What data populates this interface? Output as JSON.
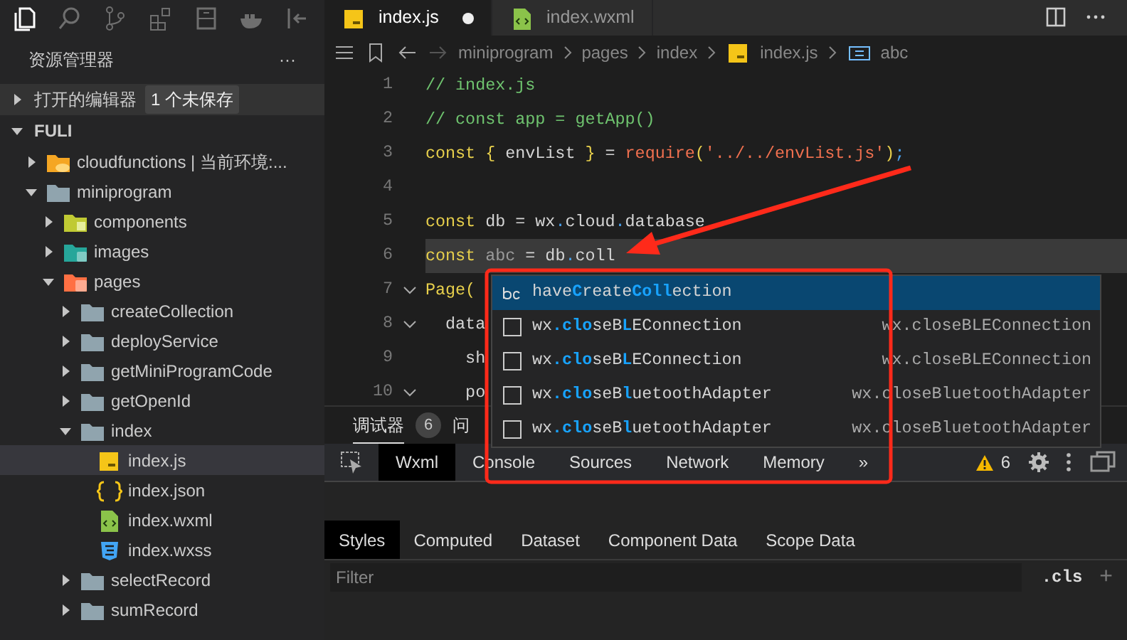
{
  "activity_bar": {
    "icons": [
      {
        "kind": "files",
        "selected": true
      },
      {
        "kind": "search",
        "selected": false
      },
      {
        "kind": "branch",
        "selected": false
      },
      {
        "kind": "extensions",
        "selected": false
      },
      {
        "kind": "storage",
        "selected": false
      },
      {
        "kind": "docker",
        "selected": false
      },
      {
        "kind": "collapse",
        "selected": false
      }
    ]
  },
  "sidebar": {
    "title": "资源管理器",
    "more": "···",
    "open_editors": {
      "label": "打开的编辑器",
      "badge": "1 个未保存",
      "expanded": false
    },
    "project": {
      "label": "FULI",
      "expanded": true
    },
    "tree": [
      {
        "label": "cloudfunctions | 当前环境:...",
        "kind": "cloud-folder",
        "expanded": false,
        "selected": false
      },
      {
        "label": "miniprogram",
        "kind": "folder",
        "expanded": true,
        "selected": false,
        "children": [
          {
            "label": "components",
            "kind": "component-folder",
            "expanded": false,
            "selected": false
          },
          {
            "label": "images",
            "kind": "image-folder",
            "expanded": false,
            "selected": false
          },
          {
            "label": "pages",
            "kind": "pages-folder",
            "expanded": true,
            "selected": false,
            "children": [
              {
                "label": "createCollection",
                "kind": "folder",
                "expanded": false,
                "selected": false
              },
              {
                "label": "deployService",
                "kind": "folder",
                "expanded": false,
                "selected": false
              },
              {
                "label": "getMiniProgramCode",
                "kind": "folder",
                "expanded": false,
                "selected": false
              },
              {
                "label": "getOpenId",
                "kind": "folder",
                "expanded": false,
                "selected": false
              },
              {
                "label": "index",
                "kind": "folder",
                "expanded": true,
                "selected": false,
                "children": [
                  {
                    "label": "index.js",
                    "kind": "js",
                    "selected": true
                  },
                  {
                    "label": "index.json",
                    "kind": "json",
                    "selected": false
                  },
                  {
                    "label": "index.wxml",
                    "kind": "wxml",
                    "selected": false
                  },
                  {
                    "label": "index.wxss",
                    "kind": "wxss",
                    "selected": false
                  }
                ]
              },
              {
                "label": "selectRecord",
                "kind": "folder",
                "expanded": false,
                "selected": false
              },
              {
                "label": "sumRecord",
                "kind": "folder",
                "expanded": false,
                "selected": false
              }
            ]
          }
        ]
      }
    ]
  },
  "editor_tabs": [
    {
      "label": "index.js",
      "kind": "js",
      "selected": true,
      "modified": true
    },
    {
      "label": "index.wxml",
      "kind": "wxml",
      "selected": false,
      "modified": false
    }
  ],
  "breadcrumb": [
    {
      "label": "miniprogram",
      "kind": "folder"
    },
    {
      "label": "pages",
      "kind": "folder"
    },
    {
      "label": "index",
      "kind": "folder"
    },
    {
      "label": "index.js",
      "kind": "js"
    },
    {
      "label": "abc",
      "kind": "symbol"
    }
  ],
  "code": [
    {
      "number": "1",
      "current": false,
      "foldable": false,
      "segments": [
        {
          "text": "// index.js",
          "kind": "comment"
        }
      ]
    },
    {
      "number": "2",
      "current": false,
      "foldable": false,
      "segments": [
        {
          "text": "// const app = getApp()",
          "kind": "comment"
        }
      ]
    },
    {
      "number": "3",
      "current": false,
      "foldable": false,
      "segments": [
        {
          "text": "const { ",
          "kind": "keyword"
        },
        {
          "text": "envList",
          "kind": "plain"
        },
        {
          "text": " } ",
          "kind": "keyword"
        },
        {
          "text": "= ",
          "kind": "plain"
        },
        {
          "text": "require",
          "kind": "call"
        },
        {
          "text": "(",
          "kind": "keyword"
        },
        {
          "text": "'../../envList.js'",
          "kind": "string"
        },
        {
          "text": ")",
          "kind": "keyword"
        },
        {
          "text": ";",
          "kind": "punct"
        }
      ]
    },
    {
      "number": "4",
      "current": false,
      "foldable": false
    },
    {
      "number": "5",
      "current": false,
      "foldable": false,
      "segments": [
        {
          "text": "const",
          "kind": "keyword"
        },
        {
          "text": " db = wx",
          "kind": "plain"
        },
        {
          "text": ".",
          "kind": "punct"
        },
        {
          "text": "cloud",
          "kind": "plain"
        },
        {
          "text": ".",
          "kind": "punct"
        },
        {
          "text": "database",
          "kind": "plain"
        }
      ]
    },
    {
      "number": "6",
      "current": true,
      "foldable": false,
      "segments": [
        {
          "text": "const",
          "kind": "keyword"
        },
        {
          "text": " abc",
          "kind": "unused"
        },
        {
          "text": " = db",
          "kind": "plain"
        },
        {
          "text": ".",
          "kind": "punct"
        },
        {
          "text": "coll",
          "kind": "plain"
        }
      ]
    },
    {
      "number": "7",
      "current": false,
      "foldable": true,
      "segments": [
        {
          "text": "Page(",
          "kind": "keyword"
        }
      ]
    },
    {
      "number": "8",
      "current": false,
      "foldable": true,
      "segments": [
        {
          "text": "  data",
          "kind": "plain"
        }
      ]
    },
    {
      "number": "9",
      "current": false,
      "foldable": false,
      "segments": [
        {
          "text": "    sh",
          "kind": "plain"
        }
      ]
    },
    {
      "number": "10",
      "current": false,
      "foldable": true,
      "segments": [
        {
          "text": "    po",
          "kind": "plain"
        }
      ]
    }
  ],
  "suggestions": [
    {
      "kind": "word",
      "selected": true,
      "label": "have**C**reate**Coll**ection"
    },
    {
      "kind": "method",
      "selected": false,
      "label": "wx**.clo**seB**L**EConnection",
      "detail": "wx.closeBLEConnection"
    },
    {
      "kind": "method",
      "selected": false,
      "label": "wx**.clo**seB**L**EConnection",
      "detail": "wx.closeBLEConnection"
    },
    {
      "kind": "method",
      "selected": false,
      "label": "wx**.clo**seB**l**uetoothAdapter",
      "detail": "wx.closeBluetoothAdapter"
    },
    {
      "kind": "method",
      "selected": false,
      "label": "wx**.clo**seB**l**uetoothAdapter",
      "detail": "wx.closeBluetoothAdapter"
    }
  ],
  "panel_tabs": [
    {
      "label": "调试器",
      "badge": "6",
      "selected": true
    },
    {
      "label": "问",
      "selected": false
    }
  ],
  "devtools": {
    "tabs": [
      {
        "label": "Wxml",
        "selected": true
      },
      {
        "label": "Console",
        "selected": false
      },
      {
        "label": "Sources",
        "selected": false
      },
      {
        "label": "Network",
        "selected": false
      },
      {
        "label": "Memory",
        "selected": false
      }
    ],
    "more": "»",
    "warnings": "6"
  },
  "styles_tabs": [
    {
      "label": "Styles",
      "selected": true
    },
    {
      "label": "Computed",
      "selected": false
    },
    {
      "label": "Dataset",
      "selected": false
    },
    {
      "label": "Component Data",
      "selected": false
    },
    {
      "label": "Scope Data",
      "selected": false
    }
  ],
  "filter": {
    "placeholder": "Filter",
    "cls": ".cls",
    "add": "+"
  }
}
